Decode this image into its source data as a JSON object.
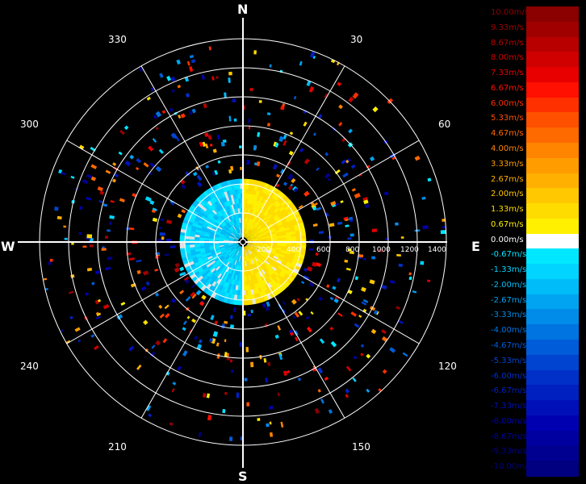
{
  "chart_data": {
    "type": "polar_radar",
    "cardinals": {
      "n": "N",
      "e": "E",
      "s": "S",
      "w": "W"
    },
    "bearings": {
      "b30": "30",
      "b60": "60",
      "b120": "120",
      "b150": "150",
      "b210": "210",
      "b240": "240",
      "b300": "300",
      "b330": "330"
    },
    "range_rings": [
      "200",
      "400",
      "600",
      "800",
      "1000",
      "1200",
      "1400"
    ],
    "velocity_scale": {
      "labels": [
        "10.00m/s",
        "9.33m/s",
        "8.67m/s",
        "8.00m/s",
        "7.33m/s",
        "6.67m/s",
        "6.00m/s",
        "5.33m/s",
        "4.67m/s",
        "4.00m/s",
        "3.33m/s",
        "2.67m/s",
        "2.00m/s",
        "1.33m/s",
        "0.67m/s",
        "0.00m/s",
        "-0.67m/s",
        "-1.33m/s",
        "-2.00m/s",
        "-2.67m/s",
        "-3.33m/s",
        "-4.00m/s",
        "-4.67m/s",
        "-5.33m/s",
        "-6.00m/s",
        "-6.67m/s",
        "-7.33m/s",
        "-8.00m/s",
        "-8.67m/s",
        "-9.33m/s",
        "-10.00m/s"
      ],
      "colors": [
        "#8b0000",
        "#a00000",
        "#b80000",
        "#d00000",
        "#e80000",
        "#ff1000",
        "#ff3000",
        "#ff5000",
        "#ff6a00",
        "#ff8400",
        "#ff9c00",
        "#ffb000",
        "#ffc800",
        "#ffdc00",
        "#fff000",
        "#ffffff",
        "#00e8ff",
        "#00d4ff",
        "#00bcf8",
        "#00a4f0",
        "#008ce8",
        "#0074e0",
        "#005cd8",
        "#0044d0",
        "#0030c8",
        "#0020c0",
        "#0010b8",
        "#0000b0",
        "#0000a0",
        "#000090",
        "#000080"
      ]
    }
  }
}
